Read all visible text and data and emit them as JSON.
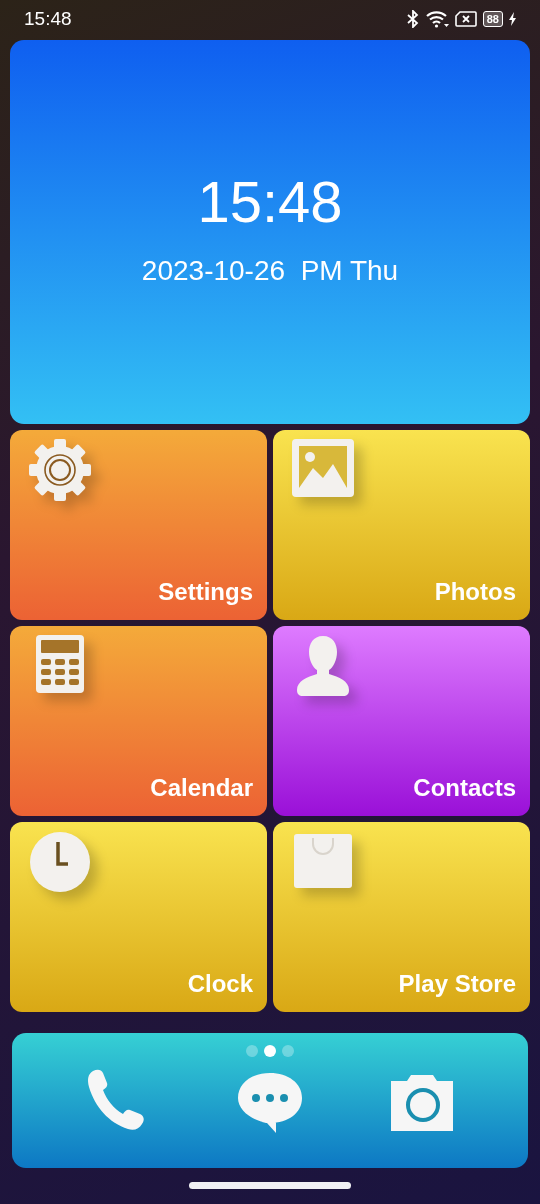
{
  "status_bar": {
    "time": "15:48",
    "battery": "88"
  },
  "clock_card": {
    "time": "15:48",
    "date": "2023-10-26  PM Thu"
  },
  "tiles": [
    {
      "label": "Settings",
      "kind": "settings"
    },
    {
      "label": "Photos",
      "kind": "photos"
    },
    {
      "label": "Calendar",
      "kind": "calendar"
    },
    {
      "label": "Contacts",
      "kind": "contacts"
    },
    {
      "label": "Clock",
      "kind": "clock"
    },
    {
      "label": "Play Store",
      "kind": "store"
    }
  ],
  "dock": {
    "page_dots": [
      {
        "selected": false
      },
      {
        "selected": true
      },
      {
        "selected": false
      }
    ],
    "apps": [
      {
        "kind": "phone"
      },
      {
        "kind": "messages"
      },
      {
        "kind": "camera"
      }
    ]
  }
}
